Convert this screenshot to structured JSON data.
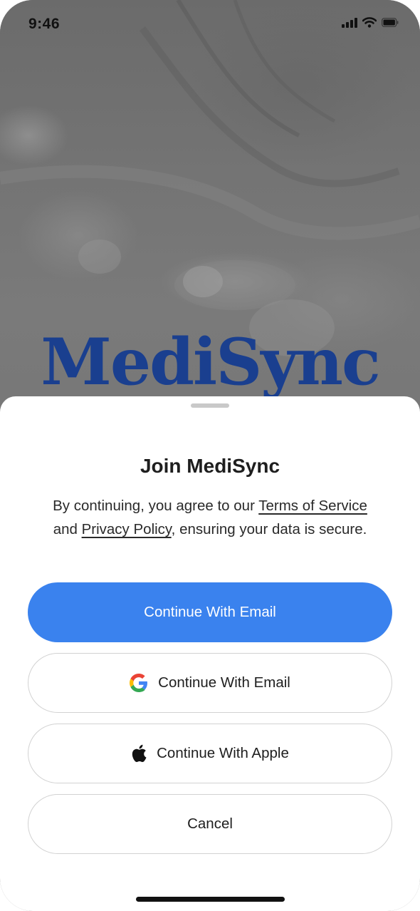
{
  "status_bar": {
    "time": "9:46"
  },
  "brand": {
    "logo_text": "MediSync",
    "color": "#1a3f8f"
  },
  "sheet": {
    "title": "Join MediSync",
    "desc_prefix": "By continuing, you agree to our ",
    "terms_link": "Terms of Service",
    "desc_middle": " and ",
    "privacy_link": "Privacy Policy",
    "desc_suffix": ", ensuring your data is secure."
  },
  "buttons": {
    "email_label": "Continue With Email",
    "google_label": "Continue With Email",
    "apple_label": "Continue With Apple",
    "cancel_label": "Cancel"
  },
  "icons": {
    "google": "google-icon",
    "apple": "apple-icon",
    "signal": "signal-icon",
    "wifi": "wifi-icon",
    "battery": "battery-icon"
  },
  "colors": {
    "primary": "#3a82ee",
    "text": "#1e1e1e",
    "border": "#d2d2d2"
  }
}
